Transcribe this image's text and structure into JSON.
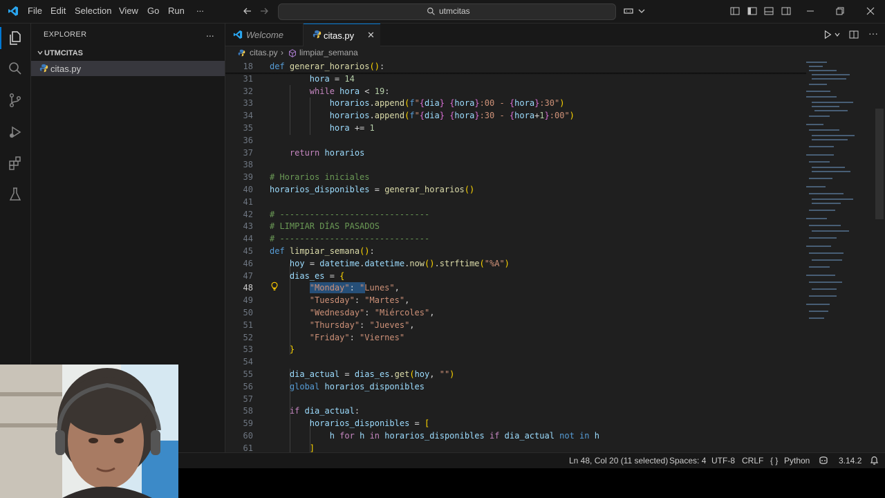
{
  "menu": [
    "File",
    "Edit",
    "Selection",
    "View",
    "Go",
    "Run",
    "..."
  ],
  "search": {
    "text": "utmcitas"
  },
  "sidebar": {
    "title": "EXPLORER",
    "more": "...",
    "folder": "UTMCITAS",
    "files": [
      {
        "name": "citas.py"
      }
    ]
  },
  "tabs": [
    {
      "label": "Welcome",
      "active": false
    },
    {
      "label": "citas.py",
      "active": true,
      "close": "✕"
    }
  ],
  "breadcrumb": {
    "file": "citas.py",
    "sep": "›",
    "symbol": "limpiar_semana"
  },
  "editor": {
    "lines": [
      {
        "n": "18",
        "tokens": [
          [
            "kw",
            "def "
          ],
          [
            "fn",
            "generar_horarios"
          ],
          [
            "br1",
            "("
          ],
          [
            "br1",
            ")"
          ],
          [
            "p",
            ":"
          ]
        ]
      },
      {
        "n": "31",
        "tokens": [
          [
            "p",
            "        "
          ],
          [
            "var",
            "hora"
          ],
          [
            "p",
            " = "
          ],
          [
            "num",
            "14"
          ]
        ]
      },
      {
        "n": "32",
        "tokens": [
          [
            "p",
            "        "
          ],
          [
            "ctl",
            "while"
          ],
          [
            "p",
            " "
          ],
          [
            "var",
            "hora"
          ],
          [
            "p",
            " < "
          ],
          [
            "num",
            "19"
          ],
          [
            "p",
            ":"
          ]
        ]
      },
      {
        "n": "33",
        "tokens": [
          [
            "p",
            "            "
          ],
          [
            "var",
            "horarios"
          ],
          [
            "p",
            "."
          ],
          [
            "fn",
            "append"
          ],
          [
            "br1",
            "("
          ],
          [
            "kw",
            "f"
          ],
          [
            "str",
            "\""
          ],
          [
            "br2",
            "{"
          ],
          [
            "var",
            "dia"
          ],
          [
            "br2",
            "}"
          ],
          [
            "str",
            " "
          ],
          [
            "br2",
            "{"
          ],
          [
            "var",
            "hora"
          ],
          [
            "br2",
            "}"
          ],
          [
            "str",
            ":00 - "
          ],
          [
            "br2",
            "{"
          ],
          [
            "var",
            "hora"
          ],
          [
            "br2",
            "}"
          ],
          [
            "str",
            ":30\""
          ],
          [
            "br1",
            ")"
          ]
        ]
      },
      {
        "n": "34",
        "tokens": [
          [
            "p",
            "            "
          ],
          [
            "var",
            "horarios"
          ],
          [
            "p",
            "."
          ],
          [
            "fn",
            "append"
          ],
          [
            "br1",
            "("
          ],
          [
            "kw",
            "f"
          ],
          [
            "str",
            "\""
          ],
          [
            "br2",
            "{"
          ],
          [
            "var",
            "dia"
          ],
          [
            "br2",
            "}"
          ],
          [
            "str",
            " "
          ],
          [
            "br2",
            "{"
          ],
          [
            "var",
            "hora"
          ],
          [
            "br2",
            "}"
          ],
          [
            "str",
            ":30 - "
          ],
          [
            "br2",
            "{"
          ],
          [
            "var",
            "hora"
          ],
          [
            "p",
            "+"
          ],
          [
            "num",
            "1"
          ],
          [
            "br2",
            "}"
          ],
          [
            "str",
            ":00\""
          ],
          [
            "br1",
            ")"
          ]
        ]
      },
      {
        "n": "35",
        "tokens": [
          [
            "p",
            "            "
          ],
          [
            "var",
            "hora"
          ],
          [
            "p",
            " += "
          ],
          [
            "num",
            "1"
          ]
        ]
      },
      {
        "n": "36",
        "tokens": []
      },
      {
        "n": "37",
        "tokens": [
          [
            "p",
            "    "
          ],
          [
            "ctl",
            "return"
          ],
          [
            "p",
            " "
          ],
          [
            "var",
            "horarios"
          ]
        ]
      },
      {
        "n": "38",
        "tokens": []
      },
      {
        "n": "39",
        "tokens": [
          [
            "cmt",
            "# Horarios iniciales"
          ]
        ]
      },
      {
        "n": "40",
        "tokens": [
          [
            "var",
            "horarios_disponibles"
          ],
          [
            "p",
            " = "
          ],
          [
            "fn",
            "generar_horarios"
          ],
          [
            "br1",
            "("
          ],
          [
            "br1",
            ")"
          ]
        ]
      },
      {
        "n": "41",
        "tokens": []
      },
      {
        "n": "42",
        "tokens": [
          [
            "cmt",
            "# ------------------------------"
          ]
        ]
      },
      {
        "n": "43",
        "tokens": [
          [
            "cmt",
            "# LIMPIAR DÍAS PASADOS"
          ]
        ]
      },
      {
        "n": "44",
        "tokens": [
          [
            "cmt",
            "# ------------------------------"
          ]
        ]
      },
      {
        "n": "45",
        "tokens": [
          [
            "kw",
            "def "
          ],
          [
            "fn",
            "limpiar_semana"
          ],
          [
            "br1",
            "("
          ],
          [
            "br1",
            ")"
          ],
          [
            "p",
            ":"
          ]
        ]
      },
      {
        "n": "46",
        "tokens": [
          [
            "p",
            "    "
          ],
          [
            "var",
            "hoy"
          ],
          [
            "p",
            " = "
          ],
          [
            "var",
            "datetime"
          ],
          [
            "p",
            "."
          ],
          [
            "var",
            "datetime"
          ],
          [
            "p",
            "."
          ],
          [
            "fn",
            "now"
          ],
          [
            "br1",
            "("
          ],
          [
            "br1",
            ")"
          ],
          [
            "p",
            "."
          ],
          [
            "fn",
            "strftime"
          ],
          [
            "br1",
            "("
          ],
          [
            "str",
            "\"%A\""
          ],
          [
            "br1",
            ")"
          ]
        ]
      },
      {
        "n": "47",
        "tokens": [
          [
            "p",
            "    "
          ],
          [
            "var",
            "dias_es"
          ],
          [
            "p",
            " = "
          ],
          [
            "br1",
            "{"
          ]
        ]
      },
      {
        "n": "48",
        "tokens": [
          [
            "p",
            "        "
          ],
          [
            "str",
            "\"Monday\""
          ],
          [
            "p",
            ": "
          ],
          [
            "str",
            "\"Lunes\""
          ],
          [
            "p",
            ","
          ]
        ]
      },
      {
        "n": "49",
        "tokens": [
          [
            "p",
            "        "
          ],
          [
            "str",
            "\"Tuesday\""
          ],
          [
            "p",
            ": "
          ],
          [
            "str",
            "\"Martes\""
          ],
          [
            "p",
            ","
          ]
        ]
      },
      {
        "n": "50",
        "tokens": [
          [
            "p",
            "        "
          ],
          [
            "str",
            "\"Wednesday\""
          ],
          [
            "p",
            ": "
          ],
          [
            "str",
            "\"Miércoles\""
          ],
          [
            "p",
            ","
          ]
        ]
      },
      {
        "n": "51",
        "tokens": [
          [
            "p",
            "        "
          ],
          [
            "str",
            "\"Thursday\""
          ],
          [
            "p",
            ": "
          ],
          [
            "str",
            "\"Jueves\""
          ],
          [
            "p",
            ","
          ]
        ]
      },
      {
        "n": "52",
        "tokens": [
          [
            "p",
            "        "
          ],
          [
            "str",
            "\"Friday\""
          ],
          [
            "p",
            ": "
          ],
          [
            "str",
            "\"Viernes\""
          ]
        ]
      },
      {
        "n": "53",
        "tokens": [
          [
            "p",
            "    "
          ],
          [
            "br1",
            "}"
          ]
        ]
      },
      {
        "n": "54",
        "tokens": []
      },
      {
        "n": "55",
        "tokens": [
          [
            "p",
            "    "
          ],
          [
            "var",
            "dia_actual"
          ],
          [
            "p",
            " = "
          ],
          [
            "var",
            "dias_es"
          ],
          [
            "p",
            "."
          ],
          [
            "fn",
            "get"
          ],
          [
            "br1",
            "("
          ],
          [
            "var",
            "hoy"
          ],
          [
            "p",
            ", "
          ],
          [
            "str",
            "\"\""
          ],
          [
            "br1",
            ")"
          ]
        ]
      },
      {
        "n": "56",
        "tokens": [
          [
            "p",
            "    "
          ],
          [
            "kw",
            "global"
          ],
          [
            "p",
            " "
          ],
          [
            "var",
            "horarios_disponibles"
          ]
        ]
      },
      {
        "n": "57",
        "tokens": []
      },
      {
        "n": "58",
        "tokens": [
          [
            "p",
            "    "
          ],
          [
            "ctl",
            "if"
          ],
          [
            "p",
            " "
          ],
          [
            "var",
            "dia_actual"
          ],
          [
            "p",
            ":"
          ]
        ]
      },
      {
        "n": "59",
        "tokens": [
          [
            "p",
            "        "
          ],
          [
            "var",
            "horarios_disponibles"
          ],
          [
            "p",
            " = "
          ],
          [
            "br1",
            "["
          ]
        ]
      },
      {
        "n": "60",
        "tokens": [
          [
            "p",
            "            "
          ],
          [
            "var",
            "h"
          ],
          [
            "p",
            " "
          ],
          [
            "ctl",
            "for"
          ],
          [
            "p",
            " "
          ],
          [
            "var",
            "h"
          ],
          [
            "p",
            " "
          ],
          [
            "ctl",
            "in"
          ],
          [
            "p",
            " "
          ],
          [
            "var",
            "horarios_disponibles"
          ],
          [
            "p",
            " "
          ],
          [
            "ctl",
            "if"
          ],
          [
            "p",
            " "
          ],
          [
            "var",
            "dia_actual"
          ],
          [
            "p",
            " "
          ],
          [
            "kw",
            "not in"
          ],
          [
            "p",
            " "
          ],
          [
            "var",
            "h"
          ]
        ]
      },
      {
        "n": "61",
        "tokens": [
          [
            "p",
            "        "
          ],
          [
            "br1",
            "]"
          ]
        ]
      }
    ],
    "current_line": "48"
  },
  "status": {
    "position": "Ln 48, Col 20 (11 selected)",
    "spaces": "Spaces: 4",
    "encoding": "UTF-8",
    "eol": "CRLF",
    "language": "Python",
    "language_icon": "{ }",
    "python_version": "3.14.2"
  },
  "colors": {
    "accent": "#0078d4",
    "editor_bg": "#1f1f1f",
    "chrome_bg": "#181818",
    "selection": "#264f78"
  }
}
